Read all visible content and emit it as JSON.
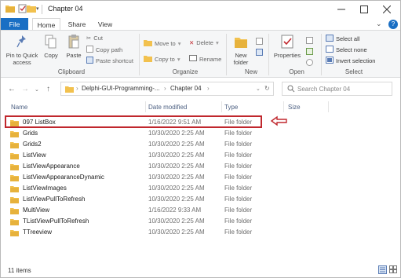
{
  "window": {
    "title": "Chapter 04"
  },
  "ribbon_tabs": [
    "File",
    "Home",
    "Share",
    "View"
  ],
  "ribbon": {
    "clipboard": {
      "pin_label": "Pin to Quick access",
      "copy_label": "Copy",
      "paste_label": "Paste",
      "cut_label": "Cut",
      "copy_path_label": "Copy path",
      "paste_shortcut_label": "Paste shortcut",
      "group_label": "Clipboard"
    },
    "organize": {
      "move_to_label": "Move to",
      "copy_to_label": "Copy to",
      "delete_label": "Delete",
      "rename_label": "Rename",
      "group_label": "Organize"
    },
    "new": {
      "new_folder_label": "New folder",
      "group_label": "New"
    },
    "open": {
      "properties_label": "Properties",
      "group_label": "Open"
    },
    "select": {
      "select_all_label": "Select all",
      "select_none_label": "Select none",
      "invert_label": "Invert selection",
      "group_label": "Select"
    }
  },
  "address": {
    "crumbs": [
      "Delphi-GUI-Programming-...",
      "Chapter 04"
    ],
    "search_placeholder": "Search Chapter 04"
  },
  "columns": [
    "Name",
    "Date modified",
    "Type",
    "Size"
  ],
  "files": [
    {
      "name": "097 ListBox",
      "date": "1/16/2022 9:51 AM",
      "type": "File folder"
    },
    {
      "name": "Grids",
      "date": "10/30/2020 2:25 AM",
      "type": "File folder"
    },
    {
      "name": "Grids2",
      "date": "10/30/2020 2:25 AM",
      "type": "File folder"
    },
    {
      "name": "ListView",
      "date": "10/30/2020 2:25 AM",
      "type": "File folder"
    },
    {
      "name": "ListViewAppearance",
      "date": "10/30/2020 2:25 AM",
      "type": "File folder"
    },
    {
      "name": "ListViewAppearanceDynamic",
      "date": "10/30/2020 2:25 AM",
      "type": "File folder"
    },
    {
      "name": "ListViewImages",
      "date": "10/30/2020 2:25 AM",
      "type": "File folder"
    },
    {
      "name": "ListViewPullToRefresh",
      "date": "10/30/2020 2:25 AM",
      "type": "File folder"
    },
    {
      "name": "MultiView",
      "date": "1/16/2022 9:33 AM",
      "type": "File folder"
    },
    {
      "name": "TListViewPullToRefresh",
      "date": "10/30/2020 2:25 AM",
      "type": "File folder"
    },
    {
      "name": "TTreeview",
      "date": "10/30/2020 2:25 AM",
      "type": "File folder"
    }
  ],
  "status": {
    "item_count": "11 items"
  },
  "colors": {
    "accent": "#1a6fc4",
    "folder": "#f2c14e",
    "highlight": "#c0272d",
    "header_text": "#4d6082"
  }
}
